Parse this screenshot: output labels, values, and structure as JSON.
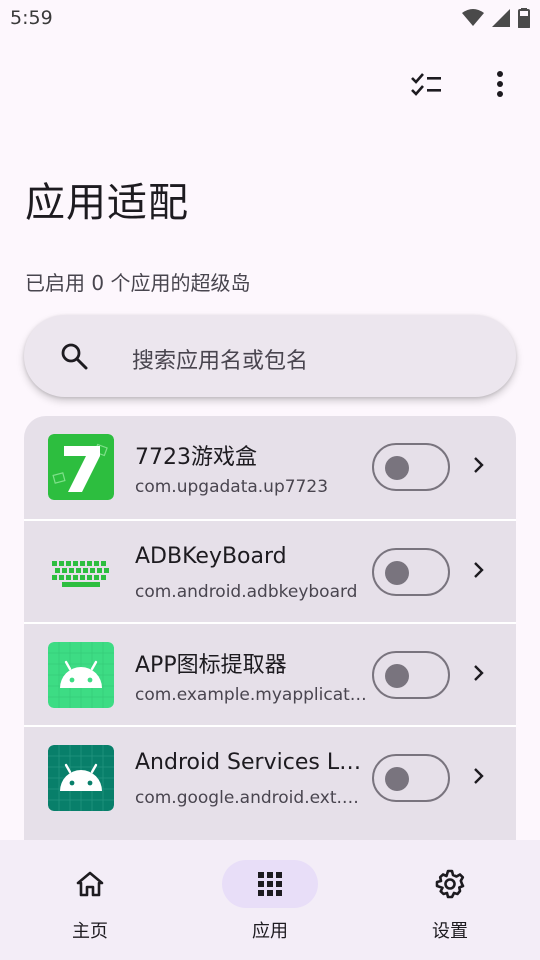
{
  "status": {
    "time": "5:59"
  },
  "header": {
    "title": "应用适配",
    "subtitle": "已启用 0 个应用的超级岛"
  },
  "search": {
    "placeholder": "搜索应用名或包名"
  },
  "apps": [
    {
      "name": "7723游戏盒",
      "package": "com.upgadata.up7723",
      "enabled": false
    },
    {
      "name": "ADBKeyBoard",
      "package": "com.android.adbkeyboard",
      "enabled": false
    },
    {
      "name": "APP图标提取器",
      "package": "com.example.myapplicat…",
      "enabled": false
    },
    {
      "name": "Android Services L…",
      "package": "com.google.android.ext.s…",
      "enabled": false
    }
  ],
  "nav": [
    {
      "label": "主页",
      "icon": "home-icon"
    },
    {
      "label": "应用",
      "icon": "apps-grid-icon",
      "active": true
    },
    {
      "label": "设置",
      "icon": "gear-icon"
    }
  ],
  "colors": {
    "background": "#FDF7FD",
    "surface": "#E6E0E9",
    "active_pill": "#E8DEF8",
    "green": "#2DBE3F"
  }
}
